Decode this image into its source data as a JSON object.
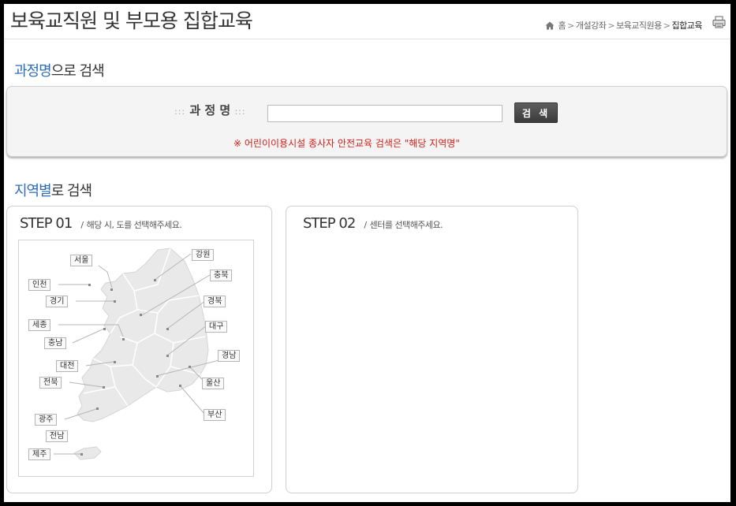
{
  "header": {
    "page_title": "보육교직원 및 부모용 집합교육",
    "breadcrumb": [
      "홈",
      "개설강좌",
      "보육교직원용",
      "집합교육"
    ]
  },
  "course_search": {
    "title_highlight": "과정명",
    "title_rest": "으로 검색",
    "label_dots_left": ":::",
    "label": "과 정 명",
    "label_dots_right": ":::",
    "input_value": "",
    "button_label": "검 색",
    "notice": "※ 어린이이용시설 종사자 안전교육 검색은 \"해당 지역명\""
  },
  "region_search": {
    "title_highlight": "지역별",
    "title_rest": "로 검색"
  },
  "step1": {
    "title": "STEP 01",
    "slash": "/",
    "description": "해당 시, 도를 선택해주세요."
  },
  "step2": {
    "title": "STEP 02",
    "slash": "/",
    "description": "센터를 선택해주세요."
  },
  "map": {
    "regions": {
      "seoul": "서울",
      "incheon": "인천",
      "gyeonggi": "경기",
      "sejong": "세종",
      "chungnam": "충남",
      "daejeon": "대전",
      "jeonbuk": "전북",
      "gwangju": "광주",
      "jeonnam": "전남",
      "jeju": "제주",
      "gangwon": "강원",
      "chungbuk": "충북",
      "gyeongbuk": "경북",
      "daegu": "대구",
      "gyeongnam": "경남",
      "ulsan": "울산",
      "busan": "부산"
    },
    "colors": {
      "land": "#e9e9e9",
      "border": "#ffffff",
      "leader": "#b5b5b5",
      "dot": "#888888"
    }
  },
  "colors": {
    "accent": "#2d6db5",
    "notice": "#d0201b",
    "button": "#4a4a4a"
  },
  "icons": {
    "home": "home-icon",
    "print": "printer-icon",
    "breadcrumb_separator": "chevron-right-icon"
  }
}
